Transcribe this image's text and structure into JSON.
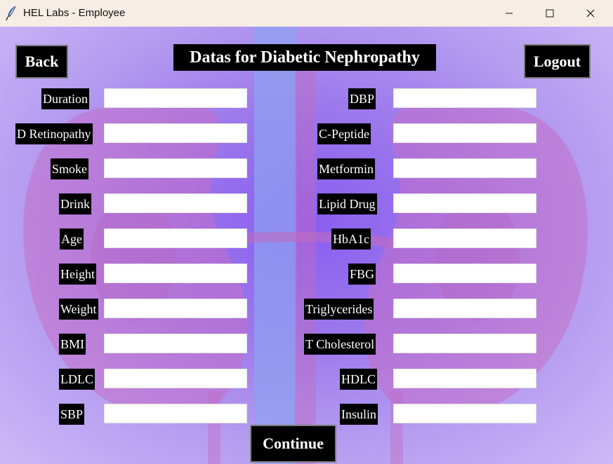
{
  "window": {
    "title": "HEL Labs - Employee",
    "icon": "feather-icon"
  },
  "header": {
    "title": "Datas for Diabetic Nephropathy",
    "back_label": "Back",
    "logout_label": "Logout"
  },
  "left_fields": [
    {
      "label": "Duration",
      "value": ""
    },
    {
      "label": "D Retinopathy",
      "value": ""
    },
    {
      "label": "Smoke",
      "value": ""
    },
    {
      "label": "Drink",
      "value": ""
    },
    {
      "label": "Age",
      "value": ""
    },
    {
      "label": "Height",
      "value": ""
    },
    {
      "label": "Weight",
      "value": ""
    },
    {
      "label": "BMI",
      "value": ""
    },
    {
      "label": "LDLC",
      "value": ""
    },
    {
      "label": "SBP",
      "value": ""
    }
  ],
  "right_fields": [
    {
      "label": "DBP",
      "value": ""
    },
    {
      "label": "C-Peptide",
      "value": ""
    },
    {
      "label": "Metformin",
      "value": ""
    },
    {
      "label": "Lipid Drug",
      "value": ""
    },
    {
      "label": "HbA1c",
      "value": ""
    },
    {
      "label": "FBG",
      "value": ""
    },
    {
      "label": "Triglycerides",
      "value": ""
    },
    {
      "label": "T Cholesterol",
      "value": ""
    },
    {
      "label": "HDLC",
      "value": ""
    },
    {
      "label": "Insulin",
      "value": ""
    }
  ],
  "footer": {
    "continue_label": "Continue"
  },
  "colors": {
    "label_bg": "#000000",
    "label_text": "#ffffff",
    "titlebar_bg": "#f6eee4",
    "background": "#9c79ec"
  }
}
